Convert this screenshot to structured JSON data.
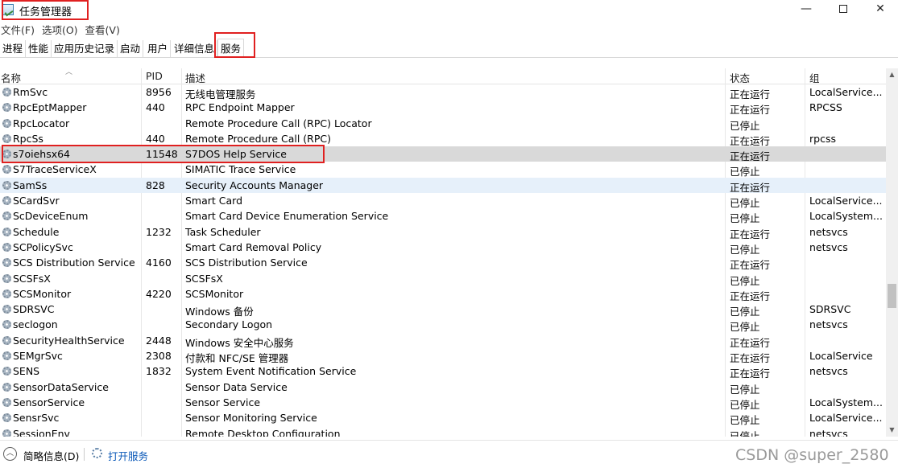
{
  "window": {
    "title": "任务管理器",
    "minimize_glyph": "—",
    "close_glyph": "✕"
  },
  "menu": [
    "文件(F)",
    "选项(O)",
    "查看(V)"
  ],
  "tabs": [
    "进程",
    "性能",
    "应用历史记录",
    "启动",
    "用户",
    "详细信息",
    "服务"
  ],
  "active_tab": "服务",
  "columns": {
    "name": "名称",
    "pid": "PID",
    "desc": "描述",
    "status": "状态",
    "group": "组"
  },
  "rows": [
    {
      "name": "RmSvc",
      "pid": "8956",
      "desc": "无线电管理服务",
      "status": "正在运行",
      "group": "LocalService..."
    },
    {
      "name": "RpcEptMapper",
      "pid": "440",
      "desc": "RPC Endpoint Mapper",
      "status": "正在运行",
      "group": "RPCSS"
    },
    {
      "name": "RpcLocator",
      "pid": "",
      "desc": "Remote Procedure Call (RPC) Locator",
      "status": "已停止",
      "group": ""
    },
    {
      "name": "RpcSs",
      "pid": "440",
      "desc": "Remote Procedure Call (RPC)",
      "status": "正在运行",
      "group": "rpcss"
    },
    {
      "name": "s7oiehsx64",
      "pid": "11548",
      "desc": "S7DOS Help Service",
      "status": "正在运行",
      "group": ""
    },
    {
      "name": "S7TraceServiceX",
      "pid": "",
      "desc": "SIMATIC Trace Service",
      "status": "已停止",
      "group": ""
    },
    {
      "name": "SamSs",
      "pid": "828",
      "desc": "Security Accounts Manager",
      "status": "正在运行",
      "group": ""
    },
    {
      "name": "SCardSvr",
      "pid": "",
      "desc": "Smart Card",
      "status": "已停止",
      "group": "LocalService..."
    },
    {
      "name": "ScDeviceEnum",
      "pid": "",
      "desc": "Smart Card Device Enumeration Service",
      "status": "已停止",
      "group": "LocalSystem..."
    },
    {
      "name": "Schedule",
      "pid": "1232",
      "desc": "Task Scheduler",
      "status": "正在运行",
      "group": "netsvcs"
    },
    {
      "name": "SCPolicySvc",
      "pid": "",
      "desc": "Smart Card Removal Policy",
      "status": "已停止",
      "group": "netsvcs"
    },
    {
      "name": "SCS Distribution Service",
      "pid": "4160",
      "desc": "SCS Distribution Service",
      "status": "正在运行",
      "group": ""
    },
    {
      "name": "SCSFsX",
      "pid": "",
      "desc": "SCSFsX",
      "status": "已停止",
      "group": ""
    },
    {
      "name": "SCSMonitor",
      "pid": "4220",
      "desc": "SCSMonitor",
      "status": "正在运行",
      "group": ""
    },
    {
      "name": "SDRSVC",
      "pid": "",
      "desc": "Windows 备份",
      "status": "已停止",
      "group": "SDRSVC"
    },
    {
      "name": "seclogon",
      "pid": "",
      "desc": "Secondary Logon",
      "status": "已停止",
      "group": "netsvcs"
    },
    {
      "name": "SecurityHealthService",
      "pid": "2448",
      "desc": "Windows 安全中心服务",
      "status": "正在运行",
      "group": ""
    },
    {
      "name": "SEMgrSvc",
      "pid": "2308",
      "desc": "付款和 NFC/SE 管理器",
      "status": "正在运行",
      "group": "LocalService"
    },
    {
      "name": "SENS",
      "pid": "1832",
      "desc": "System Event Notification Service",
      "status": "正在运行",
      "group": "netsvcs"
    },
    {
      "name": "SensorDataService",
      "pid": "",
      "desc": "Sensor Data Service",
      "status": "已停止",
      "group": ""
    },
    {
      "name": "SensorService",
      "pid": "",
      "desc": "Sensor Service",
      "status": "已停止",
      "group": "LocalSystem..."
    },
    {
      "name": "SensrSvc",
      "pid": "",
      "desc": "Sensor Monitoring Service",
      "status": "已停止",
      "group": "LocalService..."
    },
    {
      "name": "SessionEnv",
      "pid": "",
      "desc": "Remote Desktop Configuration",
      "status": "已停止",
      "group": "netsvcs"
    }
  ],
  "footer": {
    "brief": "简略信息(D)",
    "open_services": "打开服务",
    "watermark": "CSDN @super_2580"
  }
}
